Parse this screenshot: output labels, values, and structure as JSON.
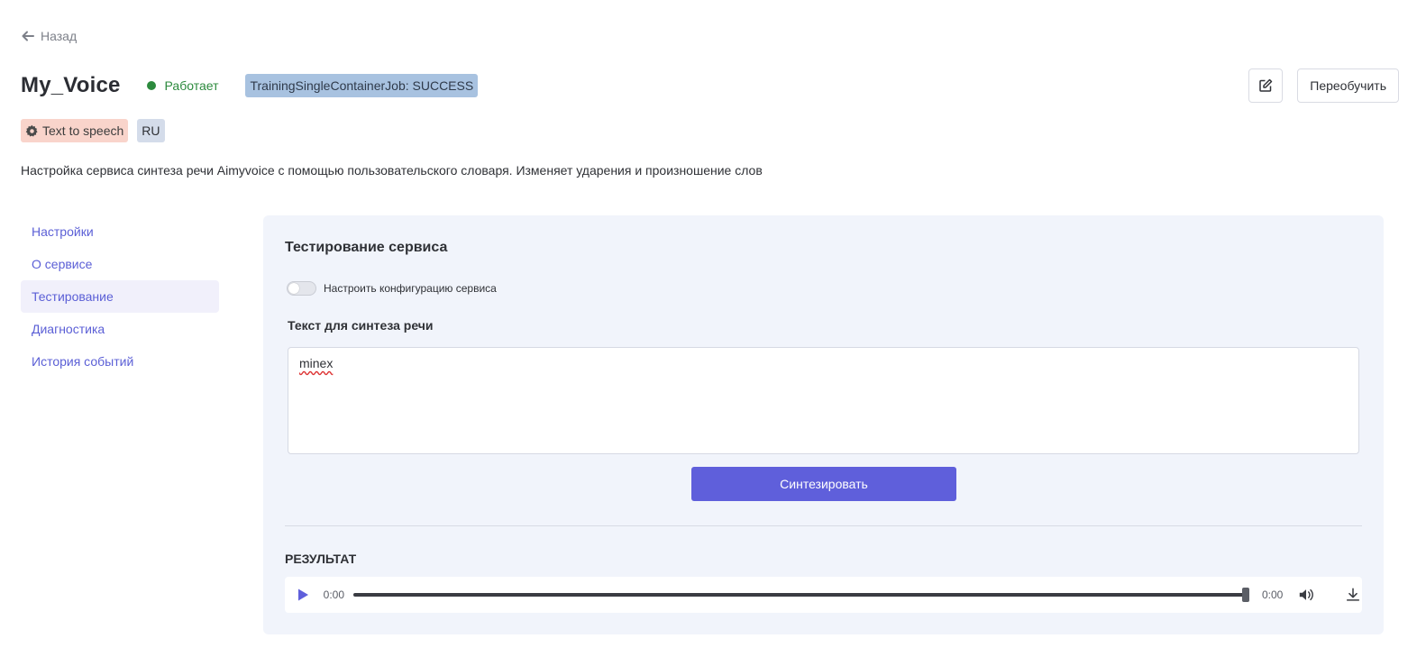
{
  "header": {
    "back_label": "Назад",
    "title": "My_Voice",
    "status_label": "Работает",
    "job_badge": "TrainingSingleContainerJob: SUCCESS",
    "retrain_label": "Переобучить"
  },
  "tags": {
    "type_label": "Text to speech",
    "lang_label": "RU"
  },
  "description": "Настройка сервиса синтеза речи Aimyvoice с помощью пользовательского словаря. Изменяет ударения и произношение слов",
  "sidebar": {
    "items": [
      {
        "label": "Настройки"
      },
      {
        "label": "О сервисе"
      },
      {
        "label": "Тестирование"
      },
      {
        "label": "Диагностика"
      },
      {
        "label": "История событий"
      }
    ],
    "active_index": 2
  },
  "panel": {
    "title": "Тестирование сервиса",
    "config_toggle_label": "Настроить конфигурацию сервиса",
    "config_toggle_on": false,
    "text_label": "Текст для синтеза речи",
    "text_value": "minex",
    "synth_button": "Синтезировать",
    "result_label": "РЕЗУЛЬТАТ"
  },
  "player": {
    "current_time": "0:00",
    "total_time": "0:00",
    "progress": 1.0
  },
  "colors": {
    "accent": "#5f5fdb",
    "status_green": "#2c8a3d",
    "job_badge_bg": "#a8c2e0",
    "tts_tag_bg": "#f9d4cb",
    "panel_bg": "#f1f4fb"
  },
  "icons": {
    "back": "arrow-left-icon",
    "edit": "edit-icon",
    "tts": "gear-icon",
    "play": "play-icon",
    "volume": "volume-icon",
    "download": "download-icon"
  }
}
